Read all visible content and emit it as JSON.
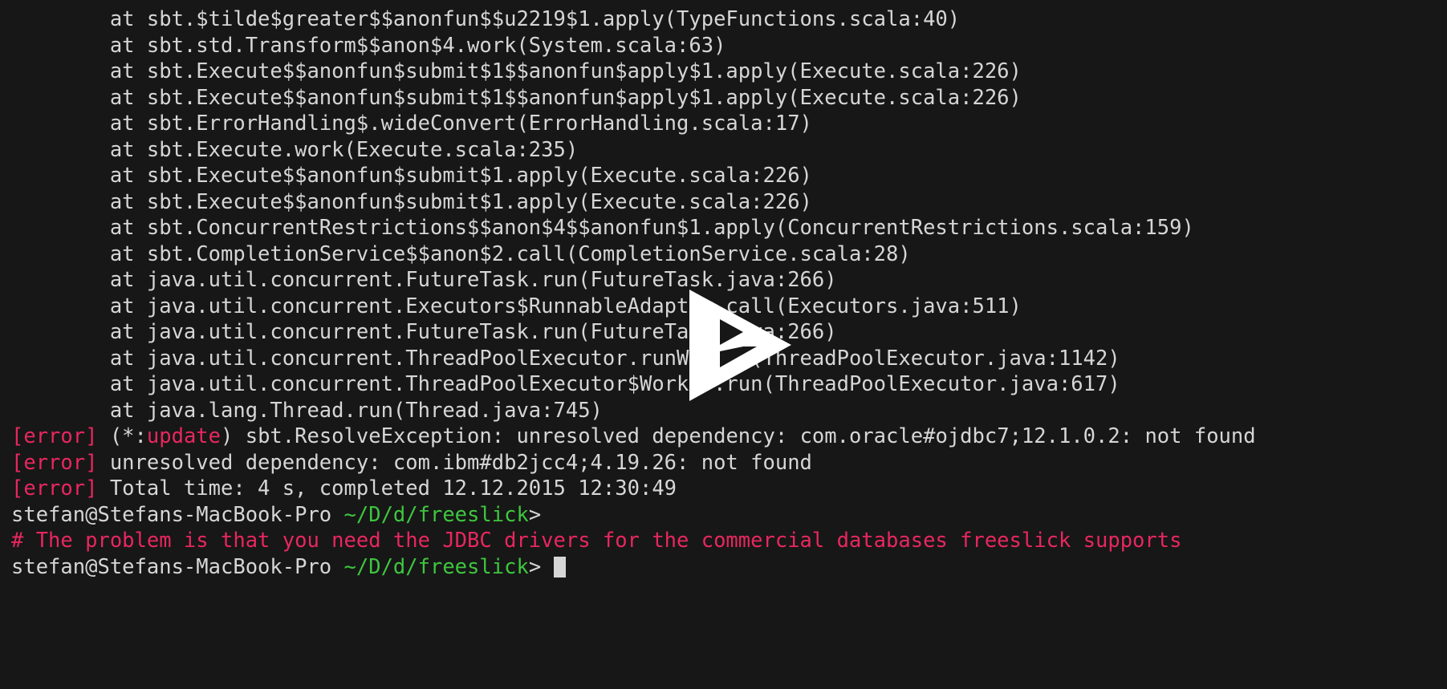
{
  "terminal": {
    "background_color": "#171717",
    "foreground_color": "#d6d6d6",
    "accent_error_color": "#e8275f",
    "accent_path_color": "#3ec63e",
    "cursor_color": "#d6d6d6",
    "stack_trace": [
      "        at sbt.$tilde$greater$$anonfun$$u2219$1.apply(TypeFunctions.scala:40)",
      "        at sbt.std.Transform$$anon$4.work(System.scala:63)",
      "        at sbt.Execute$$anonfun$submit$1$$anonfun$apply$1.apply(Execute.scala:226)",
      "        at sbt.Execute$$anonfun$submit$1$$anonfun$apply$1.apply(Execute.scala:226)",
      "        at sbt.ErrorHandling$.wideConvert(ErrorHandling.scala:17)",
      "        at sbt.Execute.work(Execute.scala:235)",
      "        at sbt.Execute$$anonfun$submit$1.apply(Execute.scala:226)",
      "        at sbt.Execute$$anonfun$submit$1.apply(Execute.scala:226)",
      "        at sbt.ConcurrentRestrictions$$anon$4$$anonfun$1.apply(ConcurrentRestrictions.scala:159)",
      "        at sbt.CompletionService$$anon$2.call(CompletionService.scala:28)",
      "        at java.util.concurrent.FutureTask.run(FutureTask.java:266)",
      "        at java.util.concurrent.Executors$RunnableAdapter.call(Executors.java:511)",
      "        at java.util.concurrent.FutureTask.run(FutureTask.java:266)",
      "        at java.util.concurrent.ThreadPoolExecutor.runWorker(ThreadPoolExecutor.java:1142)",
      "        at java.util.concurrent.ThreadPoolExecutor$Worker.run(ThreadPoolExecutor.java:617)",
      "        at java.lang.Thread.run(Thread.java:745)"
    ],
    "error_lines": [
      {
        "tag": "[error]",
        "pre": " (*:",
        "highlight": "update",
        "post": ") sbt.ResolveException: unresolved dependency: com.oracle#ojdbc7;12.1.0.2: not found"
      },
      {
        "tag": "[error]",
        "pre": " unresolved dependency: com.ibm#db2jcc4;4.19.26: not found",
        "highlight": "",
        "post": ""
      },
      {
        "tag": "[error]",
        "pre": " Total time: 4 s, completed 12.12.2015 12:30:49",
        "highlight": "",
        "post": ""
      }
    ],
    "prompt_1": {
      "user_host": "stefan@Stefans-MacBook-Pro ",
      "path": "~/D/d/freeslick",
      "symbol": ">"
    },
    "comment_line": "# The problem is that you need the JDBC drivers for the commercial databases freeslick supports",
    "prompt_2": {
      "user_host": "stefan@Stefans-MacBook-Pro ",
      "path": "~/D/d/freeslick",
      "symbol": "> "
    }
  },
  "overlay": {
    "play_button_label": "play-button"
  }
}
